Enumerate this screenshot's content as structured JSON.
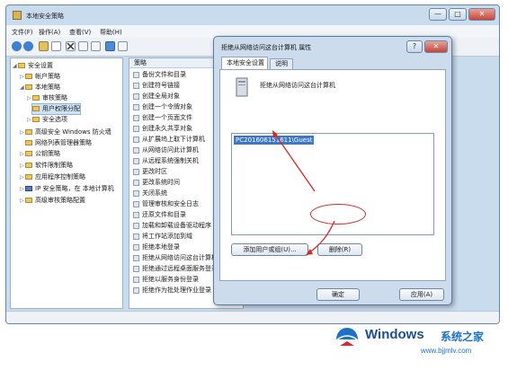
{
  "main_window": {
    "title": "本地安全策略",
    "controls": {
      "minimize": "—",
      "maximize": "□",
      "close": "✕"
    },
    "menu": [
      "文件(F)",
      "操作(A)",
      "查看(V)",
      "帮助(H)"
    ],
    "tree": [
      {
        "label": "安全设置",
        "expander": "◢"
      },
      {
        "label": "帐户策略",
        "expander": "▷"
      },
      {
        "label": "本地策略",
        "expander": "◢"
      },
      {
        "label": "审核策略",
        "expander": "▷"
      },
      {
        "label": "用户权限分配",
        "expander": ""
      },
      {
        "label": "安全选项",
        "expander": "▷"
      },
      {
        "label": "高级安全 Windows 防火墙",
        "expander": "▷"
      },
      {
        "label": "网络列表管理器策略",
        "expander": ""
      },
      {
        "label": "公钥策略",
        "expander": "▷"
      },
      {
        "label": "软件限制策略",
        "expander": "▷"
      },
      {
        "label": "应用程序控制策略",
        "expander": "▷"
      },
      {
        "label": "IP 安全策略，在 本地计算机",
        "expander": "▷"
      },
      {
        "label": "高级审核策略配置",
        "expander": "▷"
      }
    ],
    "list_header": "策略",
    "policies": [
      "备份文件和目录",
      "创建符号链接",
      "创建全局对象",
      "创建一个令牌对象",
      "创建一个页面文件",
      "创建永久共享对象",
      "从扩展坞上取下计算机",
      "从网络访问此计算机",
      "从远程系统强制关机",
      "更改时区",
      "更改系统时间",
      "关闭系统",
      "管理审核和安全日志",
      "还原文件和目录",
      "加载和卸载设备驱动程序",
      "将工作站添加到域",
      "拒绝本地登录",
      "拒绝从网络访问这台计算机",
      "拒绝通过远程桌面服务登录",
      "拒绝以服务身份登录",
      "拒绝作为批处理作业登录"
    ]
  },
  "dialog": {
    "title": "拒绝从网络访问这台计算机 属性",
    "help": "?",
    "close": "✕",
    "tabs": [
      "本地安全设置",
      "说明"
    ],
    "policy_name": "拒绝从网络访问这台计算机",
    "users": [
      "PC201606151611\\Guest"
    ],
    "add_button": "添加用户或组(U)...",
    "remove_button": "删除(R)",
    "ok_button": "确定",
    "apply_button": "应用(A)"
  },
  "watermark": {
    "brand": "Windows",
    "tagline": "系统之家",
    "url": "www.bjjmlv.com"
  },
  "colors": {
    "accent_red": "#d62626",
    "selection_blue": "#3a78c6",
    "window_frame": "#c9dcee"
  }
}
